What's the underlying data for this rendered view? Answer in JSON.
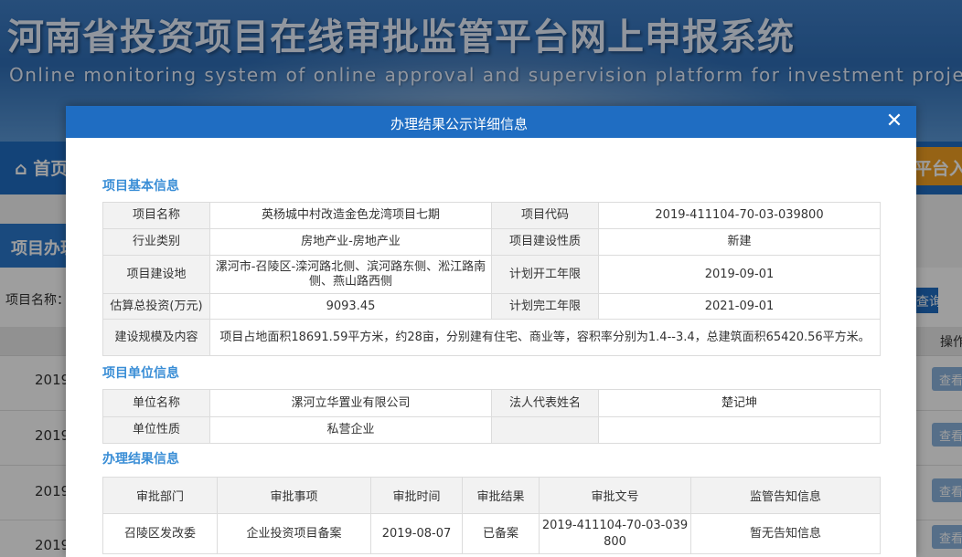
{
  "page": {
    "banner_title": "河南省投资项目在线审批监管平台网上申报系统",
    "banner_subtitle": "Online monitoring system of online approval and supervision platform for investment projects in Henan",
    "nav_home": "首页",
    "nav_right": "平台入",
    "section_tab": "项目办理",
    "filter_label": "项目名称：",
    "query_button": "查询",
    "table_op_header": "操作",
    "rows": [
      {
        "year": "2019",
        "action": "查看"
      },
      {
        "year": "2019",
        "action": "查看"
      },
      {
        "year": "2019",
        "action": "查看"
      },
      {
        "year": "2019",
        "action": "查看"
      }
    ]
  },
  "modal": {
    "title": "办理结果公示详细信息",
    "close_label": "✕",
    "basic_section_title": "项目基本信息",
    "basic": {
      "project_name_label": "项目名称",
      "project_name": "英杨城中村改造金色龙湾项目七期",
      "project_code_label": "项目代码",
      "project_code": "2019-411104-70-03-039800",
      "industry_label": "行业类别",
      "industry": "房地产业-房地产业",
      "nature_label": "项目建设性质",
      "nature": "新建",
      "location_label": "项目建设地",
      "location": "漯河市-召陵区-滦河路北侧、滨河路东侧、淞江路南侧、燕山路西侧",
      "start_label": "计划开工年限",
      "start": "2019-09-01",
      "investment_label": "估算总投资(万元)",
      "investment": "9093.45",
      "finish_label": "计划完工年限",
      "finish": "2021-09-01",
      "scale_label": "建设规模及内容",
      "scale": "项目占地面积18691.59平方米，约28亩，分别建有住宅、商业等，容积率分别为1.4--3.4，总建筑面积65420.56平方米。"
    },
    "unit_section_title": "项目单位信息",
    "unit": {
      "name_label": "单位名称",
      "name": "漯河立华置业有限公司",
      "legal_label": "法人代表姓名",
      "legal": "楚记坤",
      "type_label": "单位性质",
      "type": "私营企业"
    },
    "result_section_title": "办理结果信息",
    "result": {
      "headers": [
        "审批部门",
        "审批事项",
        "审批时间",
        "审批结果",
        "审批文号",
        "监管告知信息"
      ],
      "row": [
        "召陵区发改委",
        "企业投资项目备案",
        "2019-08-07",
        "已备案",
        "2019-411104-70-03-039800",
        "暂无告知信息"
      ]
    }
  }
}
